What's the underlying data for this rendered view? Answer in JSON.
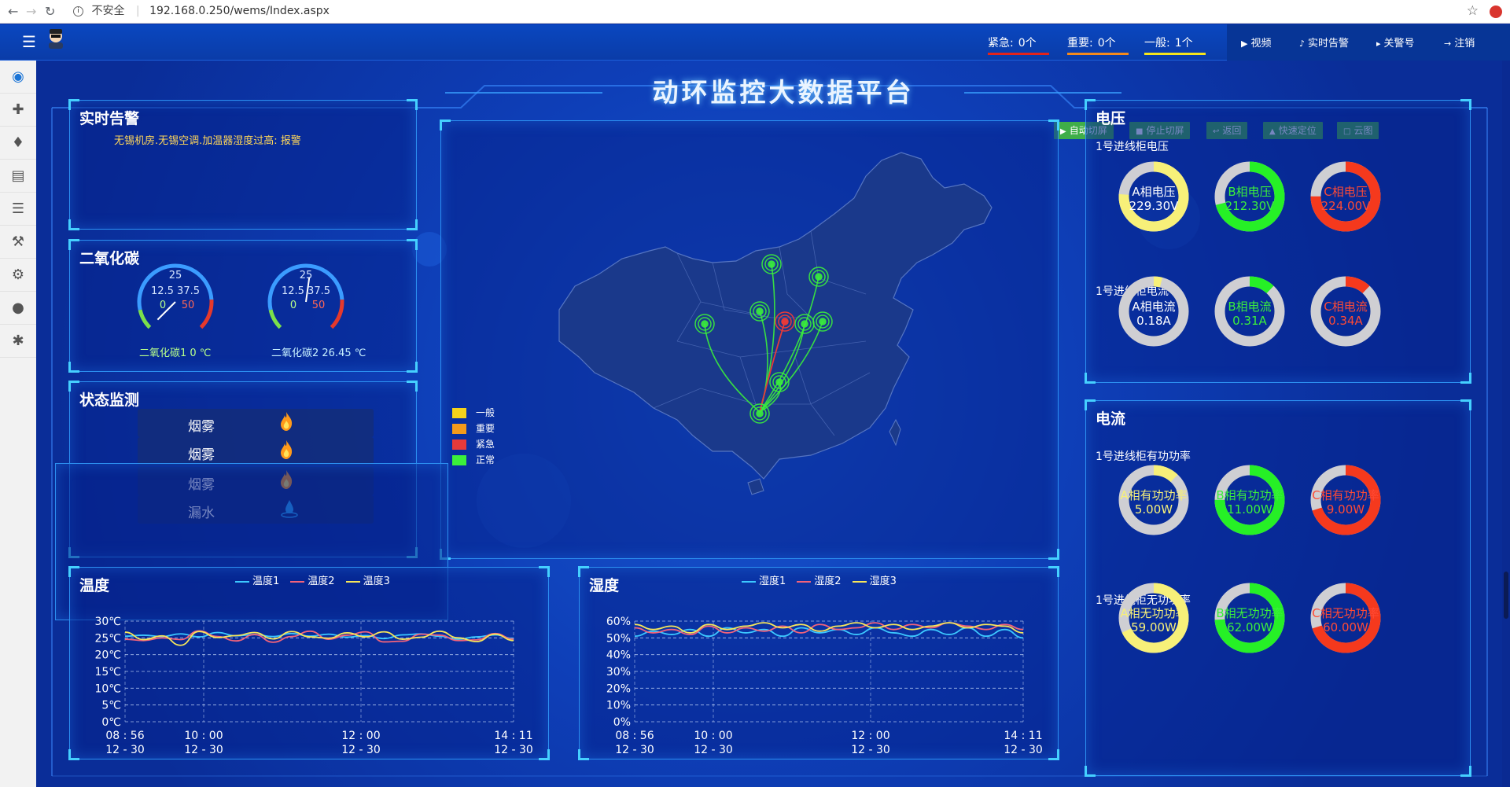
{
  "browser": {
    "insecure_label": "不安全",
    "url": "192.168.0.250/wems/Index.aspx"
  },
  "appbar": {
    "alarms": [
      {
        "label": "紧急:",
        "count": "0个",
        "color": "#e4231a"
      },
      {
        "label": "重要:",
        "count": "0个",
        "color": "#f58a1b"
      },
      {
        "label": "一般:",
        "count": "1个",
        "color": "#f5e51b"
      }
    ],
    "buttons": [
      {
        "icon": "video-icon",
        "label": "视频"
      },
      {
        "icon": "bell-icon",
        "label": "实时告警"
      },
      {
        "icon": "megaphone-icon",
        "label": "关警号"
      },
      {
        "icon": "logout-icon",
        "label": "注销"
      }
    ]
  },
  "sidebar": {
    "items": [
      "eye-icon",
      "crosshair-icon",
      "bell-icon",
      "bar-chart-icon",
      "list-icon",
      "wrench-icon",
      "gears-icon",
      "user-icon",
      "settings-icon"
    ]
  },
  "header": {
    "title": "动环监控大数据平台",
    "controls": [
      "自动切屏",
      "停止切屏",
      "返回",
      "快速定位",
      "云图"
    ]
  },
  "realtime_alarm": {
    "title": "实时告警",
    "message": "无锡机房.无锡空调.加温器湿度过高: 报警"
  },
  "co2": {
    "title": "二氧化碳",
    "gauges": [
      {
        "scale_top": "25",
        "scale_mid": "12.5 37.5",
        "scale_low": "0",
        "scale_high": "50",
        "label": "二氧化碳1 0 ℃",
        "value": 0
      },
      {
        "scale_top": "25",
        "scale_mid": "12.5 37.5",
        "scale_low": "0",
        "scale_high": "50",
        "label": "二氧化碳2 26.45 ℃",
        "value": 26.45
      }
    ]
  },
  "status": {
    "title": "状态监测",
    "items": [
      {
        "name": "烟雾",
        "icon": "flame-icon"
      },
      {
        "name": "烟雾",
        "icon": "flame-icon"
      },
      {
        "name": "烟雾",
        "icon": "flame-icon"
      },
      {
        "name": "漏水",
        "icon": "water-drop-icon"
      }
    ]
  },
  "map": {
    "legend": [
      {
        "label": "一般",
        "color": "#f5d31b"
      },
      {
        "label": "重要",
        "color": "#f59a1b"
      },
      {
        "label": "紧急",
        "color": "#e63a3a"
      },
      {
        "label": "正常",
        "color": "#3bf03b"
      }
    ]
  },
  "voltage_panel": {
    "title": "电压",
    "groups": [
      {
        "subtitle": "1号进线柜电压",
        "rings": [
          {
            "name": "A相电压",
            "value": "229.30V",
            "fraction": 0.76,
            "color": "#f7f079",
            "text_color": "#ffffff"
          },
          {
            "name": "B相电压",
            "value": "212.30V",
            "fraction": 0.71,
            "color": "#26f026",
            "text_color": "#3bf03b"
          },
          {
            "name": "C相电压",
            "value": "224.00V",
            "fraction": 0.75,
            "color": "#f5391d",
            "text_color": "#ff4a35"
          }
        ]
      },
      {
        "subtitle": "1号进线柜电流",
        "rings": [
          {
            "name": "A相电流",
            "value": "0.18A",
            "fraction": 0.04,
            "color": "#f7f079",
            "text_color": "#ffffff"
          },
          {
            "name": "B相电流",
            "value": "0.31A",
            "fraction": 0.12,
            "color": "#26f026",
            "text_color": "#3bf03b"
          },
          {
            "name": "C相电流",
            "value": "0.34A",
            "fraction": 0.12,
            "color": "#f5391d",
            "text_color": "#ff4a35"
          }
        ]
      }
    ]
  },
  "current_panel": {
    "title": "电流",
    "groups": [
      {
        "subtitle": "1号进线柜有功功率",
        "rings": [
          {
            "name": "A相有功功率",
            "value": "5.00W",
            "fraction": 0.12,
            "color": "#f7f079",
            "text_color": "#f7f079"
          },
          {
            "name": "B相有功功率",
            "value": "11.00W",
            "fraction": 0.75,
            "color": "#26f026",
            "text_color": "#3bf03b"
          },
          {
            "name": "C相有功功率",
            "value": "9.00W",
            "fraction": 0.7,
            "color": "#f5391d",
            "text_color": "#ff4a35"
          }
        ]
      },
      {
        "subtitle": "1号进线柜无功功率",
        "rings": [
          {
            "name": "A相无功功率",
            "value": "59.00W",
            "fraction": 0.68,
            "color": "#f7f079",
            "text_color": "#f7f079"
          },
          {
            "name": "B相无功功率",
            "value": "62.00W",
            "fraction": 0.74,
            "color": "#26f026",
            "text_color": "#3bf03b"
          },
          {
            "name": "C相无功功率",
            "value": "60.00W",
            "fraction": 0.7,
            "color": "#f5391d",
            "text_color": "#ff4a35"
          }
        ]
      }
    ]
  },
  "temp_title": "温度",
  "humid_title": "湿度",
  "chart_data": [
    {
      "type": "line",
      "title": "温度",
      "ylim": [
        0,
        30
      ],
      "yticks": [
        "0℃",
        "5℃",
        "10℃",
        "15℃",
        "20℃",
        "25℃",
        "30℃"
      ],
      "xticks": [
        [
          "08 : 56",
          "12 - 30"
        ],
        [
          "10 : 00",
          "12 - 30"
        ],
        [
          "12 : 00",
          "12 - 30"
        ],
        [
          "14 : 11",
          "12 - 30"
        ]
      ],
      "grid": true,
      "legend_position": "top-center",
      "series": [
        {
          "name": "温度1",
          "color": "#3cc8ff",
          "values": [
            25.5,
            25.8,
            25.4,
            26.2,
            25.3,
            26.6,
            25.6,
            26.0,
            25.4,
            26.3,
            25.5,
            26.1,
            25.2,
            25.7,
            24.8,
            25.9,
            26.2,
            25.5,
            24.6,
            25.3,
            25.9,
            24.8
          ]
        },
        {
          "name": "温度2",
          "color": "#f2637b",
          "values": [
            24.6,
            24.2,
            25.0,
            24.5,
            27.1,
            25.4,
            24.1,
            26.0,
            23.7,
            25.4,
            27.0,
            24.6,
            25.8,
            26.8,
            23.8,
            24.0,
            26.1,
            25.8,
            24.2,
            24.4,
            26.3,
            24.6
          ]
        },
        {
          "name": "温度3",
          "color": "#f7e65a",
          "values": [
            26.7,
            24.5,
            25.6,
            22.8,
            26.9,
            25.1,
            25.7,
            26.6,
            24.7,
            26.9,
            25.3,
            24.9,
            26.5,
            25.3,
            26.8,
            24.6,
            25.2,
            27.0,
            25.0,
            23.9,
            26.1,
            24.2
          ]
        }
      ]
    },
    {
      "type": "line",
      "title": "湿度",
      "ylim": [
        0,
        60
      ],
      "yticks": [
        "0%",
        "10%",
        "20%",
        "30%",
        "40%",
        "50%",
        "60%"
      ],
      "xticks": [
        [
          "08 : 56",
          "12 - 30"
        ],
        [
          "10 : 00",
          "12 - 30"
        ],
        [
          "12 : 00",
          "12 - 30"
        ],
        [
          "14 : 11",
          "12 - 30"
        ]
      ],
      "grid": true,
      "legend_position": "top-center",
      "series": [
        {
          "name": "湿度1",
          "color": "#3cc8ff",
          "values": [
            51,
            54,
            52,
            55,
            51,
            56,
            53,
            55,
            51,
            56,
            53,
            55,
            52,
            56,
            53,
            51,
            55,
            52,
            56,
            51,
            55,
            50
          ]
        },
        {
          "name": "湿度2",
          "color": "#f2637b",
          "values": [
            56,
            53,
            55,
            52,
            57,
            53,
            56,
            54,
            57,
            53,
            58,
            55,
            56,
            59,
            55,
            58,
            56,
            59,
            57,
            55,
            58,
            55
          ]
        },
        {
          "name": "湿度3",
          "color": "#f7e65a",
          "values": [
            58,
            55,
            57,
            53,
            58,
            55,
            57,
            59,
            56,
            58,
            54,
            57,
            59,
            56,
            58,
            55,
            57,
            59,
            56,
            58,
            57,
            53
          ]
        }
      ]
    }
  ]
}
